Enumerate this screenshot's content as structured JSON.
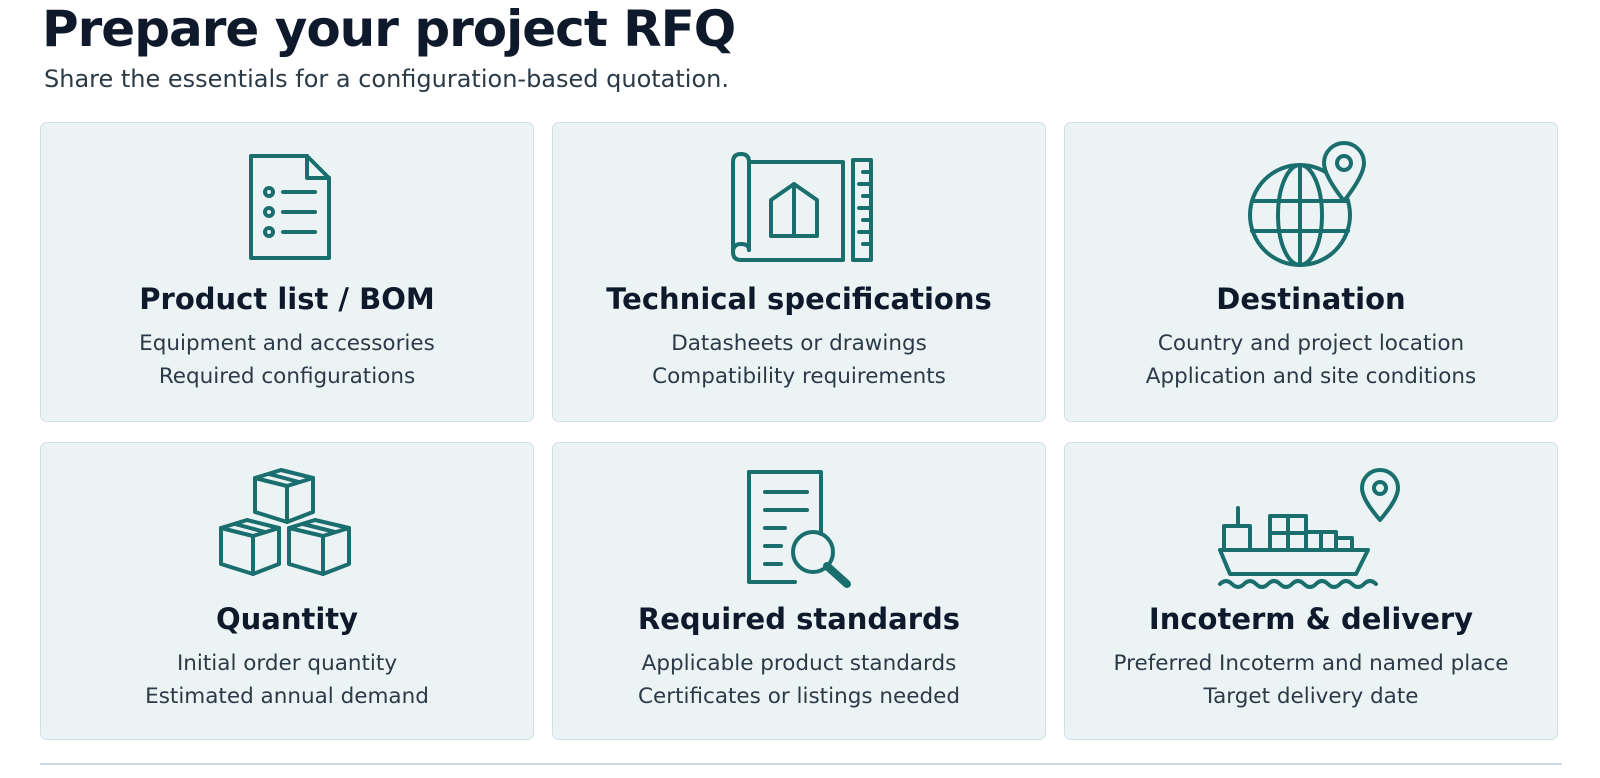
{
  "header": {
    "title": "Prepare your project RFQ",
    "subtitle": "Share the essentials for a configuration-based quotation."
  },
  "theme": {
    "icon_color": "#1a6e6e",
    "card_background": "#ebf3f5",
    "card_border": "#cfe0e4"
  },
  "cards": [
    {
      "icon": "document-list-icon",
      "title": "Product list / BOM",
      "lines": [
        "Equipment and accessories",
        "Required configurations"
      ]
    },
    {
      "icon": "blueprint-ruler-icon",
      "title": "Technical specifications",
      "lines": [
        "Datasheets or drawings",
        "Compatibility requirements"
      ]
    },
    {
      "icon": "globe-pin-icon",
      "title": "Destination",
      "lines": [
        "Country and project location",
        "Application and site conditions"
      ]
    },
    {
      "icon": "stacked-boxes-icon",
      "title": "Quantity",
      "lines": [
        "Initial order quantity",
        "Estimated annual demand"
      ]
    },
    {
      "icon": "document-search-icon",
      "title": "Required standards",
      "lines": [
        "Applicable product standards",
        "Certificates or listings needed"
      ]
    },
    {
      "icon": "cargo-ship-pin-icon",
      "title": "Incoterm & delivery",
      "lines": [
        "Preferred Incoterm and named place",
        "Target delivery date"
      ]
    }
  ]
}
